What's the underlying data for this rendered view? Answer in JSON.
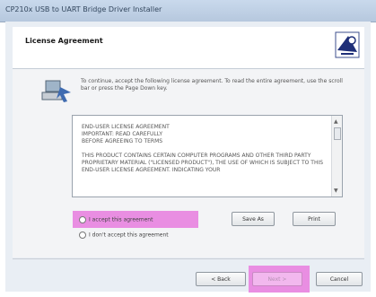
{
  "window": {
    "title": "CP210x USB to UART Bridge Driver Installer"
  },
  "header": {
    "title": "License Agreement"
  },
  "intro": "To continue, accept the following license agreement. To read the entire agreement, use the scroll bar or press the Page Down key.",
  "license": {
    "text": "END-USER LICENSE AGREEMENT\nIMPORTANT: READ CAREFULLY\nBEFORE AGREEING TO TERMS\n\nTHIS PRODUCT CONTAINS CERTAIN COMPUTER PROGRAMS AND OTHER THIRD PARTY PROPRIETARY MATERIAL (\"LICENSED PRODUCT\"), THE USE OF WHICH IS SUBJECT TO THIS END-USER LICENSE AGREEMENT. INDICATING YOUR"
  },
  "buttons": {
    "save_as": "Save As",
    "print": "Print",
    "back": "< Back",
    "next": "Next >",
    "cancel": "Cancel"
  },
  "radios": {
    "accept": "I accept this agreement",
    "decline": "I don't accept this agreement"
  },
  "colors": {
    "highlight": "#e98ee2",
    "titlebar": "#c9d9ec"
  },
  "icons": {
    "logo": "usb-installer-logo",
    "installer": "computer-install-icon"
  }
}
